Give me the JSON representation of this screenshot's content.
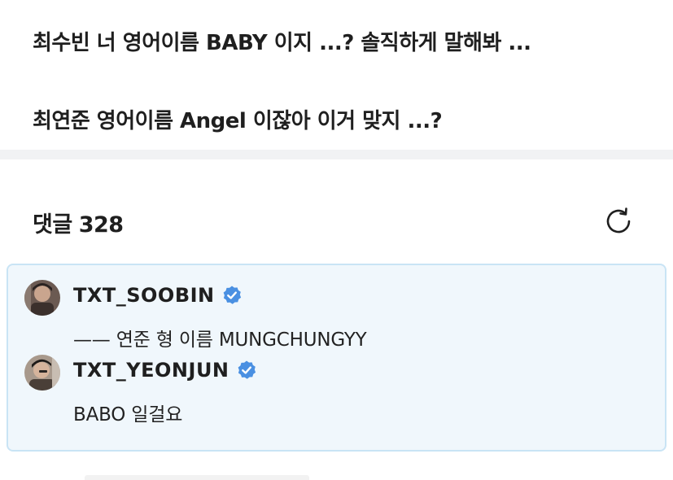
{
  "post": {
    "line1": "최수빈 너 영어이름 BABY 이지 ...? 솔직하게 말해봐 ...",
    "line2": "최연준 영어이름 Angel 이잖아 이거 맞지 ...?"
  },
  "comments_header": {
    "label": "댓글",
    "count": "328",
    "refresh_icon": "refresh-icon"
  },
  "highlight": {
    "comments": [
      {
        "author": "TXT_SOOBIN",
        "verified": true,
        "text": "—— 연준 형 이름 MUNGCHUNGYY",
        "avatar": "avatar-photo"
      },
      {
        "author": "TXT_YEONJUN",
        "verified": true,
        "text": "BABO 일걸요",
        "avatar": "avatar-photo"
      }
    ]
  },
  "colors": {
    "highlight_bg": "#f0f7fc",
    "highlight_border": "#c9e4f5",
    "verified_blue": "#4a90e2",
    "divider": "#f1f2f4"
  }
}
